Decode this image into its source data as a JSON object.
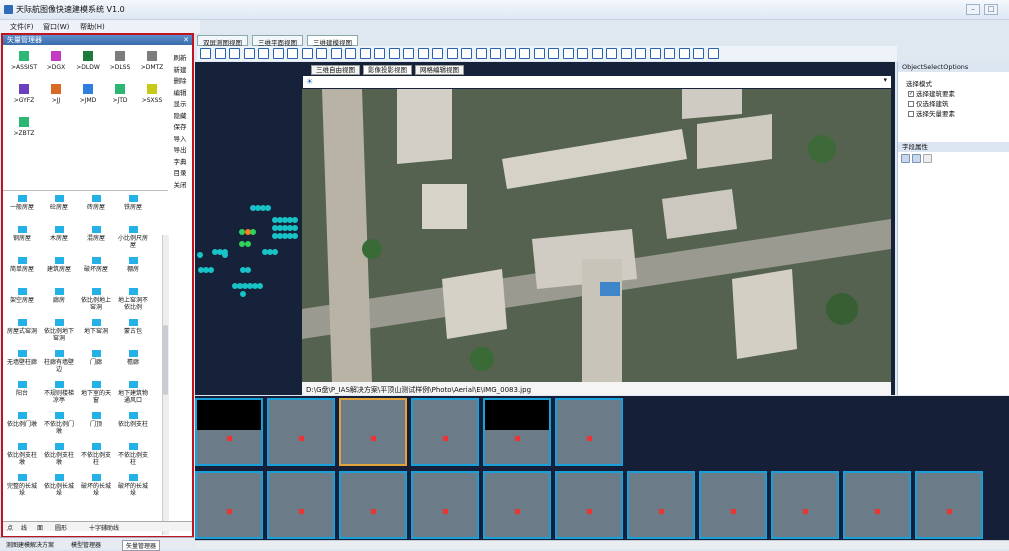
{
  "window": {
    "title": "天际航图像快速建模系统 V1.0"
  },
  "menu": [
    "文件(F)",
    "窗口(W)",
    "帮助(H)"
  ],
  "left_panel": {
    "title": "矢量管理器",
    "layers": [
      {
        "label": ">ASSIST",
        "color": "#2bb673"
      },
      {
        "label": ">DGX",
        "color": "#c13ac1"
      },
      {
        "label": ">DLDW",
        "color": "#1f7a3a"
      },
      {
        "label": ">DLSS",
        "color": "#7d7d7d"
      },
      {
        "label": ">DMTZ",
        "color": "#7d7d7d"
      },
      {
        "label": ">GYFZ",
        "color": "#6a3fc0"
      },
      {
        "label": ">JJ",
        "color": "#d86a24"
      },
      {
        "label": ">JMD",
        "color": "#2f7fe0"
      },
      {
        "label": ">JTD",
        "color": "#2bb673"
      },
      {
        "label": ">SXSS",
        "color": "#c6c91a"
      },
      {
        "label": ">ZBTZ",
        "color": "#2bb673"
      }
    ],
    "side_buttons": [
      "刷新",
      "新建",
      "删除",
      "编辑",
      "显示",
      "隐藏",
      "保存",
      "导入",
      "导出",
      "字典",
      "目录",
      "关闭"
    ],
    "symbols": [
      "一般房屋",
      "砼房屋",
      "砖房屋",
      "铁房屋",
      "钢房屋",
      "木房屋",
      "混房屋",
      "小比例尺房屋",
      "简单房屋",
      "建筑房屋",
      "破坏房屋",
      "棚房",
      "架空房屋",
      "廊房",
      "依比例地上窑洞",
      "地上窑洞不依比例",
      "房屋式窑洞",
      "依比例地下窑洞",
      "地下窑洞",
      "蒙古包",
      "无墙壁柱廊",
      "柱廊有墙壁边",
      "门廊",
      "檐廊",
      "阳台",
      "不规则楼梯凉亭",
      "地下室的天窗",
      "地下建筑物通风口",
      "依比例门墩",
      "不依比例门墩",
      "门顶",
      "依比例支柱",
      "依比例支柱墩",
      "依比例支柱墩",
      "不依比例支柱",
      "不依比例支柱",
      "完整的长城垛",
      "依比例长城垛",
      "破坏的长城垛",
      "破坏的长城垛"
    ],
    "bottom_row": [
      "点",
      "线",
      "面",
      "圆形",
      "十字辅助线"
    ],
    "tabs": [
      "测图建模解决方案",
      "模型管理器",
      "矢量管理器"
    ]
  },
  "main_tabs": [
    "双屏测图视图",
    "三维平面视图",
    "三维建模视图"
  ],
  "view_tabs": [
    "三维自由视图",
    "影像投影视图",
    "网格编辑视图"
  ],
  "status_path": "D:\\G盘\\P_IAS解决方案\\平顶山测试样例\\Photo\\Aerial\\E\\IMG_0083.jpg",
  "right_panel": {
    "title": "ObjectSelectOptions",
    "group": "选择模式",
    "options": [
      {
        "label": "选择建筑要素",
        "checked": true
      },
      {
        "label": "仅选择建筑",
        "checked": false
      },
      {
        "label": "选择矢量要素",
        "checked": false
      }
    ],
    "props_title": "字段属性"
  },
  "scene_legend": {
    "dot_color": "#18c3c8",
    "selected_color": "#ff7a1a",
    "active_color": "#2fd35a"
  }
}
